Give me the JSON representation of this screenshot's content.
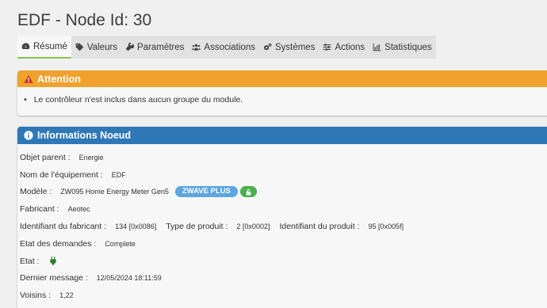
{
  "page": {
    "title": "EDF - Node Id: 30"
  },
  "tabs": [
    {
      "label": "Résumé",
      "icon": "dashboard-icon",
      "active": true
    },
    {
      "label": "Valeurs",
      "icon": "tag-icon"
    },
    {
      "label": "Paramètres",
      "icon": "wrench-icon"
    },
    {
      "label": "Associations",
      "icon": "users-icon"
    },
    {
      "label": "Systèmes",
      "icon": "cogs-icon"
    },
    {
      "label": "Actions",
      "icon": "sliders-icon"
    },
    {
      "label": "Statistiques",
      "icon": "chart-icon"
    }
  ],
  "attention": {
    "title": "Attention",
    "message": "Le contrôleur n'est inclus dans aucun groupe du module."
  },
  "info": {
    "title": "Informations Noeud",
    "parent_label": "Objet parent :",
    "parent_value": "Energie",
    "name_label": "Nom de l'équipement :",
    "name_value": "EDF",
    "model_label": "Modèle :",
    "model_value": "ZW095 Home Energy Meter Gen5",
    "zwave_badge": "ZWAVE PLUS",
    "maker_label": "Fabricant :",
    "maker_value": "Aeotec",
    "maker_id_label": "Identifiant du fabricant :",
    "maker_id_value": "134 [0x0086]",
    "product_type_label": "Type de produit :",
    "product_type_value": "2 [0x0002]",
    "product_id_label": "Identifiant du produit :",
    "product_id_value": "95 [0x005f]",
    "requests_label": "Etat des demandes :",
    "requests_value": "Complete",
    "state_label": "Etat :",
    "last_msg_label": "Dernier message :",
    "last_msg_value": "12/05/2024 18:11:59",
    "neighbors_label": "Voisins :",
    "neighbors_value": "1,22"
  },
  "colors": {
    "attention": "#f1a22c",
    "info": "#2e78b7",
    "active_tab": "#8bc34a",
    "badge_blue": "#5da5e0",
    "badge_green": "#4caf50"
  }
}
